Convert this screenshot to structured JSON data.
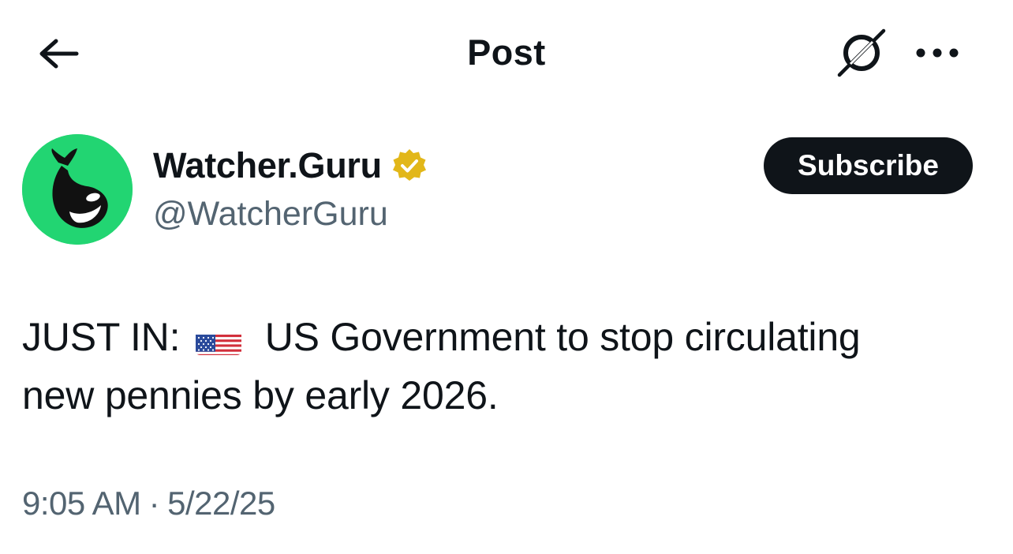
{
  "header": {
    "title": "Post",
    "back_icon": "arrow-left-icon",
    "grok_icon": "grok-icon",
    "more_icon": "more-horizontal-icon"
  },
  "author": {
    "display_name": "Watcher.Guru",
    "handle": "@WatcherGuru",
    "verified_icon": "verified-badge-icon",
    "verified_color": "#e2b719",
    "avatar_bg": "#22d572",
    "subscribe_label": "Subscribe"
  },
  "post": {
    "text_prefix": "JUST IN:",
    "flag_icon": "us-flag-icon",
    "text_line1": "US Government to stop circulating",
    "text_line2": "new pennies by early 2026."
  },
  "meta": {
    "time": "9:05 AM",
    "separator": "·",
    "date": "5/22/25"
  },
  "colors": {
    "text_primary": "#0f1419",
    "text_secondary": "#536471",
    "button_bg": "#0f1419"
  }
}
